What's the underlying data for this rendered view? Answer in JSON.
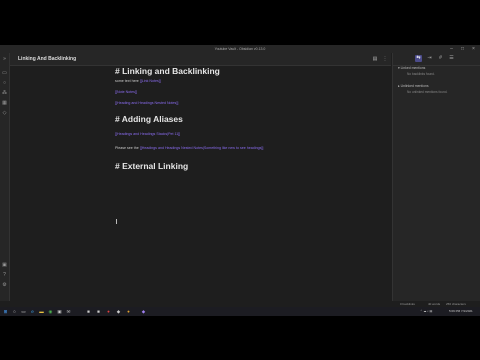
{
  "window": {
    "title": "Youtube Vault - Obsidian v0.13.0",
    "minimize_icon": "minimize-icon",
    "maximize_icon": "maximize-icon",
    "close_icon": "close-icon"
  },
  "ribbon": {
    "icons": [
      "collapse-icon",
      "file-explorer-icon",
      "search-icon",
      "graph-icon",
      "calendar-icon",
      "tag-icon"
    ],
    "bottom_icons": [
      "vault-icon",
      "help-icon",
      "settings-icon"
    ]
  },
  "tab": {
    "title": "Linking And Backlinking",
    "actions": [
      "preview-icon",
      "more-options-icon"
    ]
  },
  "document": {
    "h1": "# Linking and Backlinking",
    "line1_text": "some text here ",
    "line1_link": "[[Link Notes]]",
    "line2_link": "[[Note Notes]]",
    "line3_link": "[[Heading and Headings Nested Notes]]",
    "h2": "# Adding Aliases",
    "line4_link": "[[Headings and Headings Stacks|Pet 11]]",
    "line5_text": "Please see the ",
    "line5_link": "[[Headings and Headings Nested Notes|Something like new to see headings]]",
    "h3": "# External Linking"
  },
  "right_panel": {
    "tab_icons": [
      "backlinks-icon",
      "outgoing-links-icon",
      "tags-icon",
      "outline-icon"
    ],
    "linked_title": "Linked mentions",
    "linked_empty": "No backlinks found.",
    "unlinked_title": "Unlinked mentions",
    "unlinked_empty": "No unlinked mentions found."
  },
  "status": {
    "backlinks": "0 backlinks",
    "words": "40 words",
    "characters": "256 characters"
  },
  "taskbar": {
    "time": "5:09 PM",
    "date": "7/1/2021",
    "icons": [
      "windows-start-icon",
      "search-icon",
      "task-view-icon",
      "edge-icon",
      "file-explorer-icon",
      "chrome-icon",
      "store-icon",
      "mail-icon",
      "obsidian-icon",
      "app-icon",
      "app-icon",
      "app-icon",
      "app-icon",
      "app-icon"
    ]
  }
}
